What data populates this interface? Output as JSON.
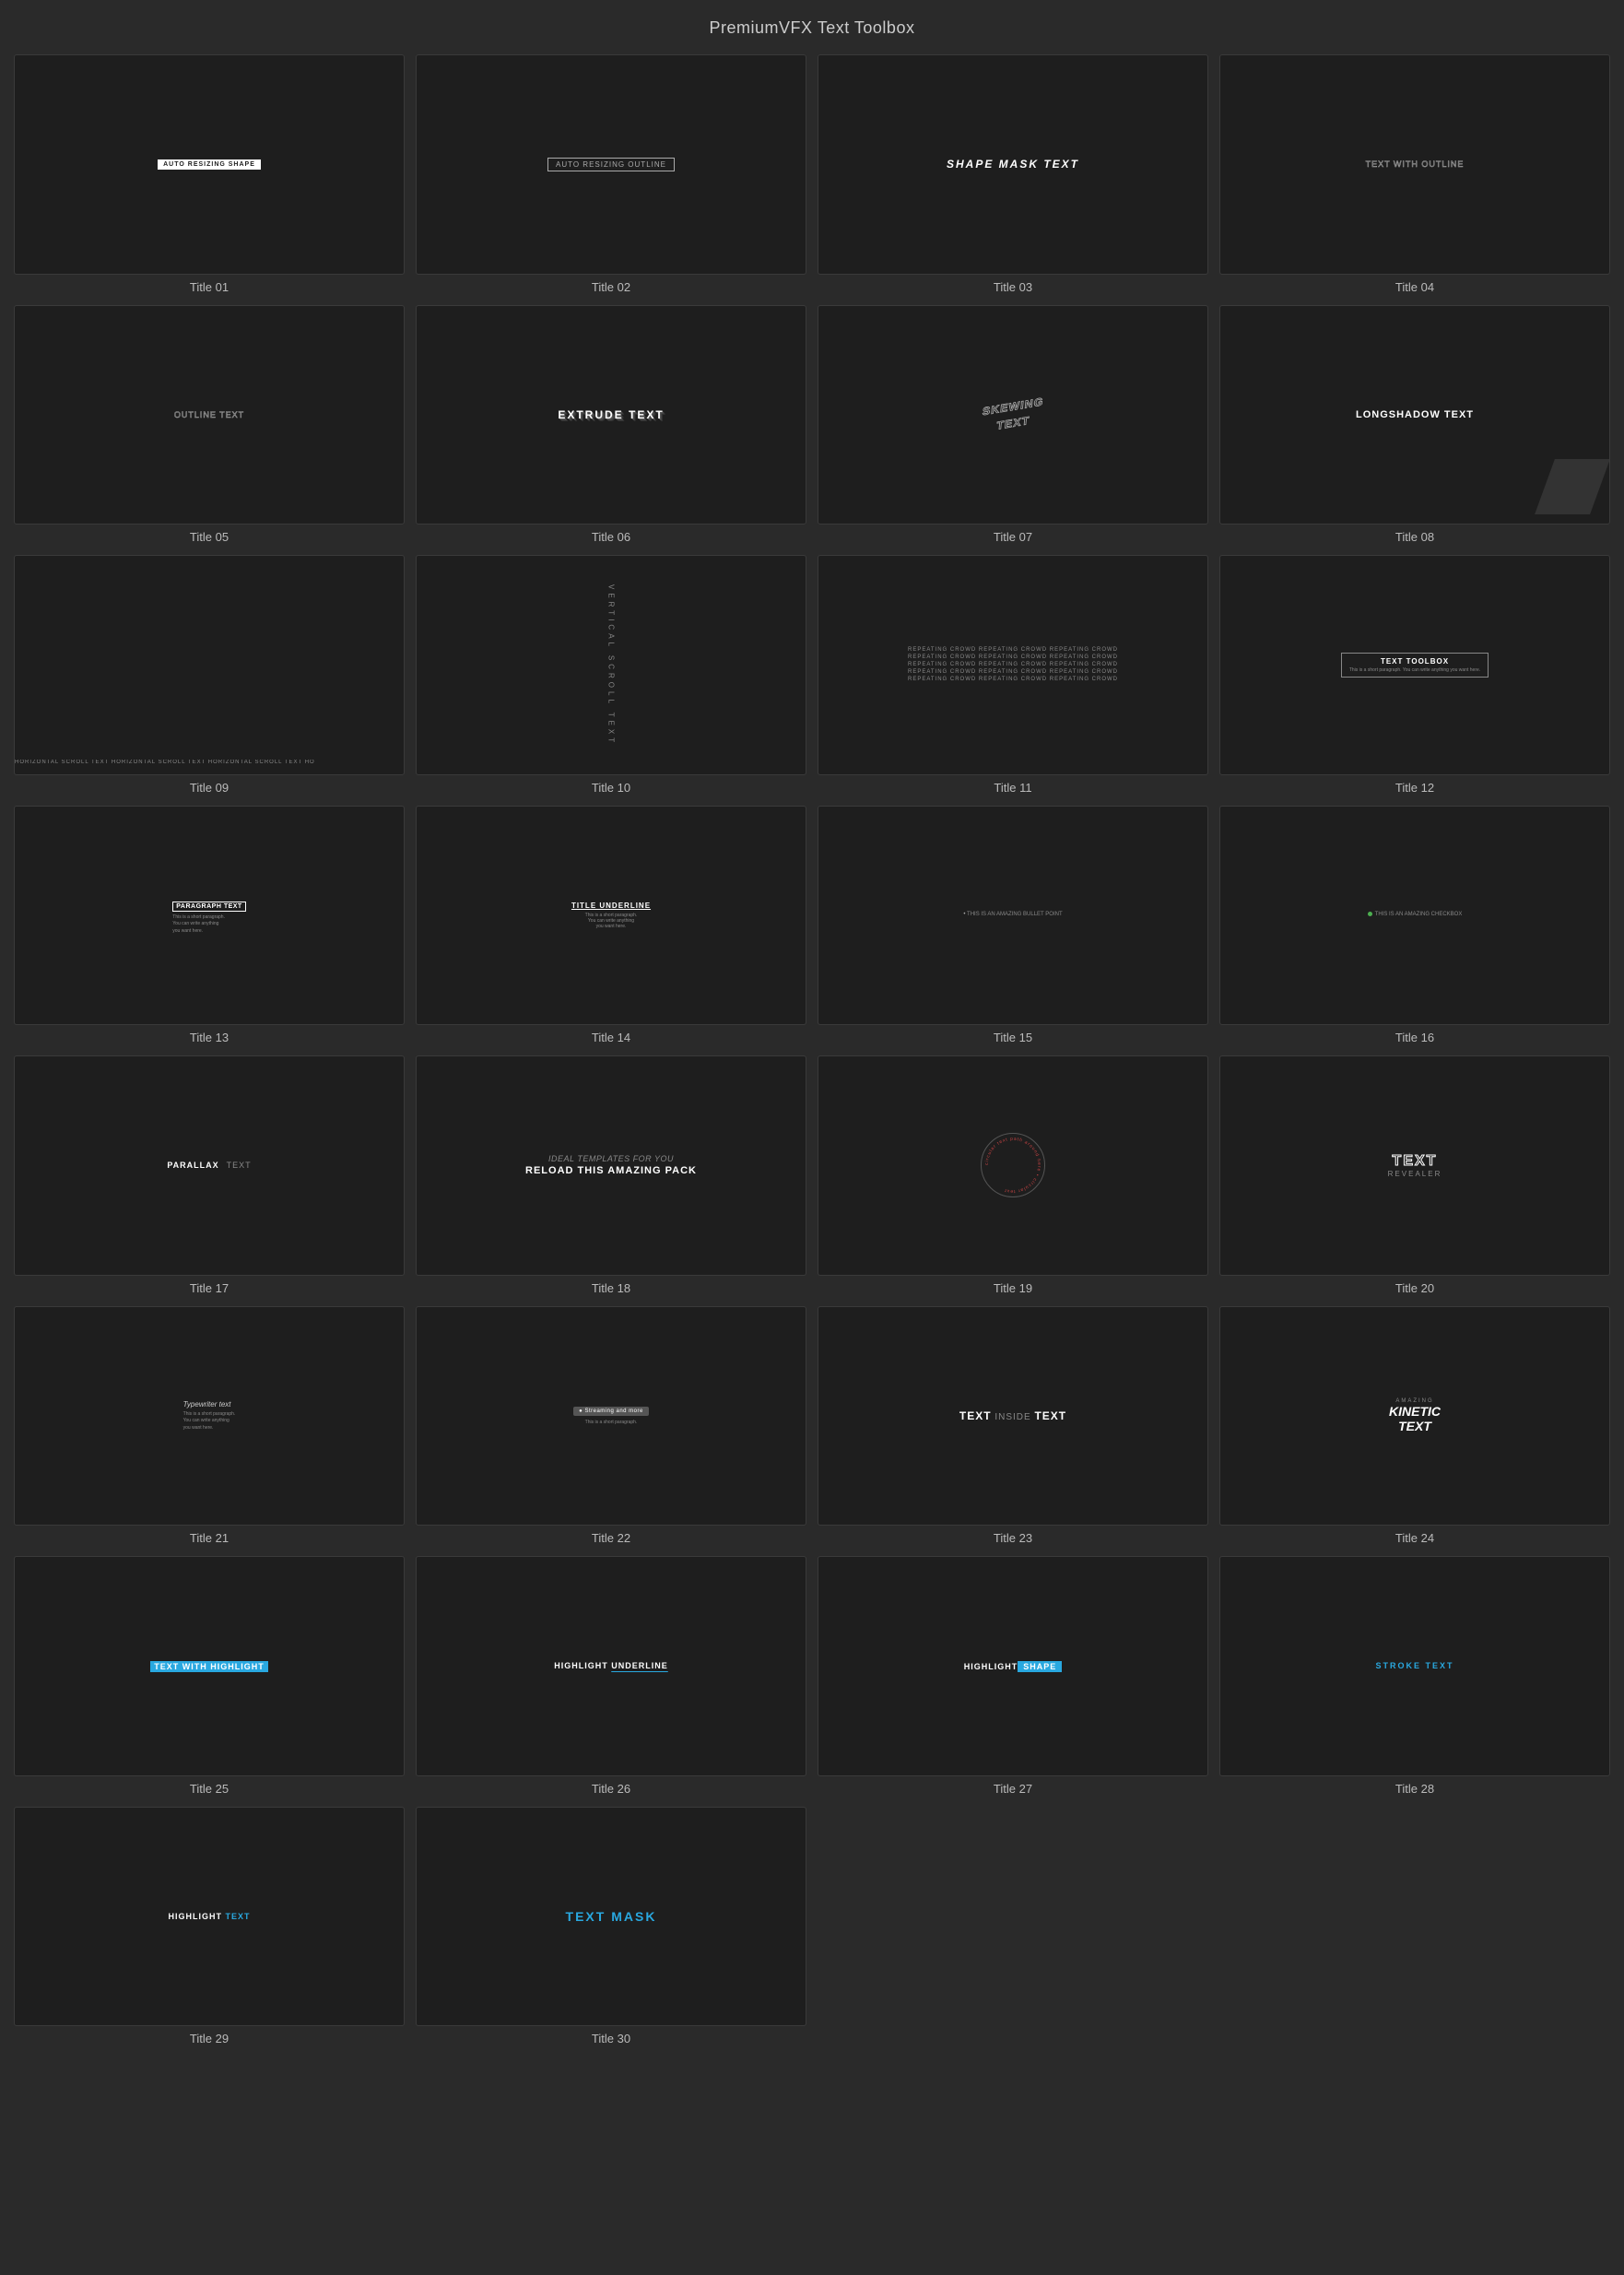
{
  "page": {
    "title": "PremiumVFX Text Toolbox"
  },
  "items": [
    {
      "id": "01",
      "label": "Title 01",
      "thumb_type": "auto-resizing-shape",
      "thumb_text": "AUTO RESIZING SHAPE"
    },
    {
      "id": "02",
      "label": "Title 02",
      "thumb_type": "auto-resizing-outline",
      "thumb_text": "AUTO RESIZING OUTLINE"
    },
    {
      "id": "03",
      "label": "Title 03",
      "thumb_type": "shape-mask-text",
      "thumb_text": "SHAPE MASK TEXT"
    },
    {
      "id": "04",
      "label": "Title 04",
      "thumb_type": "text-with-outline",
      "thumb_text": "TEXT WITH OUTLINE"
    },
    {
      "id": "05",
      "label": "Title 05",
      "thumb_type": "outline-text",
      "thumb_text": "OUTLINE TEXT"
    },
    {
      "id": "06",
      "label": "Title 06",
      "thumb_type": "extrude-text",
      "thumb_text": "EXTRUDE TEXT"
    },
    {
      "id": "07",
      "label": "Title 07",
      "thumb_type": "skew-text",
      "thumb_text": "SKEWING TEXT"
    },
    {
      "id": "08",
      "label": "Title 08",
      "thumb_type": "longshadow-text",
      "thumb_text": "LONGSHADOW TEXT"
    },
    {
      "id": "09",
      "label": "Title 09",
      "thumb_type": "horizontal-scroll",
      "thumb_text": "HORIZONTAL SCROLL TEXT HORIZONTAL SCROLL TEXT HORIZONTAL SCROLL TEXT HO"
    },
    {
      "id": "10",
      "label": "Title 10",
      "thumb_type": "vertical-scroll",
      "thumb_text": "VERTICAL SCROLL TEXT"
    },
    {
      "id": "11",
      "label": "Title 11",
      "thumb_type": "repeating-text",
      "thumb_text": "Repeating Crowd Repeating Crowd Repeating Crowd"
    },
    {
      "id": "12",
      "label": "Title 12",
      "thumb_type": "text-toolbox",
      "thumb_text": "TEXT TOOLBOX",
      "thumb_sub": "This is a short paragraph. You can write anything you want here."
    },
    {
      "id": "13",
      "label": "Title 13",
      "thumb_type": "paragraph-text",
      "thumb_text": "PARAGRAPH TEXT",
      "thumb_sub": "This is a short paragraph. You can write anything you want here."
    },
    {
      "id": "14",
      "label": "Title 14",
      "thumb_type": "title-underline",
      "thumb_text": "TITLE UNDERLINE",
      "thumb_sub": "This is a short paragraph. You can write anything you want here."
    },
    {
      "id": "15",
      "label": "Title 15",
      "thumb_type": "bullet-point",
      "thumb_text": "THIS IS AN AMAZING BULLET POINT"
    },
    {
      "id": "16",
      "label": "Title 16",
      "thumb_type": "checkbox",
      "thumb_text": "THIS IS AN AMAZING CHECKBOX"
    },
    {
      "id": "17",
      "label": "Title 17",
      "thumb_type": "parallax-text",
      "thumb_text": "PARALLAX TEXT"
    },
    {
      "id": "18",
      "label": "Title 18",
      "thumb_type": "promo-text",
      "thumb_main": "IDEAL TEMPLATES FOR YOU",
      "thumb_sub": "RELOAD THIS AMAZING PACK"
    },
    {
      "id": "19",
      "label": "Title 19",
      "thumb_type": "circular-text",
      "thumb_text": "circular text"
    },
    {
      "id": "20",
      "label": "Title 20",
      "thumb_type": "text-revealer",
      "thumb_text": "TEXT",
      "thumb_sub": "REVEALER"
    },
    {
      "id": "21",
      "label": "Title 21",
      "thumb_type": "typewriter",
      "thumb_text": "Typewriter text",
      "thumb_sub": "This is a short paragraph. You can write anything you want here."
    },
    {
      "id": "22",
      "label": "Title 22",
      "thumb_type": "streaming-text",
      "thumb_text": "Streaming and more",
      "thumb_sub": "This is a short paragraph."
    },
    {
      "id": "23",
      "label": "Title 23",
      "thumb_type": "text-inside-text",
      "thumb_text": "TEXT INSIDE TEXT"
    },
    {
      "id": "24",
      "label": "Title 24",
      "thumb_type": "kinetic-text",
      "thumb_text": "KINETIC TEXT",
      "thumb_sub": "AMAZING"
    },
    {
      "id": "25",
      "label": "Title 25",
      "thumb_type": "highlight-text",
      "thumb_text": "TEXT WITH HIGHLIGHT"
    },
    {
      "id": "26",
      "label": "Title 26",
      "thumb_type": "highlight-underline",
      "thumb_text": "HIGHLIGHT UNDERLINE"
    },
    {
      "id": "27",
      "label": "Title 27",
      "thumb_type": "highlight-shape",
      "thumb_text": "HIGHLIGHT SHAPE"
    },
    {
      "id": "28",
      "label": "Title 28",
      "thumb_type": "stroke-text",
      "thumb_text": "STROKE TEXT"
    },
    {
      "id": "29",
      "label": "Title 29",
      "thumb_type": "highlight-text-2",
      "thumb_text": "HIGHLIGHT TEXT"
    },
    {
      "id": "30",
      "label": "Title 30",
      "thumb_type": "text-mask",
      "thumb_text": "TEXT MASK"
    }
  ]
}
